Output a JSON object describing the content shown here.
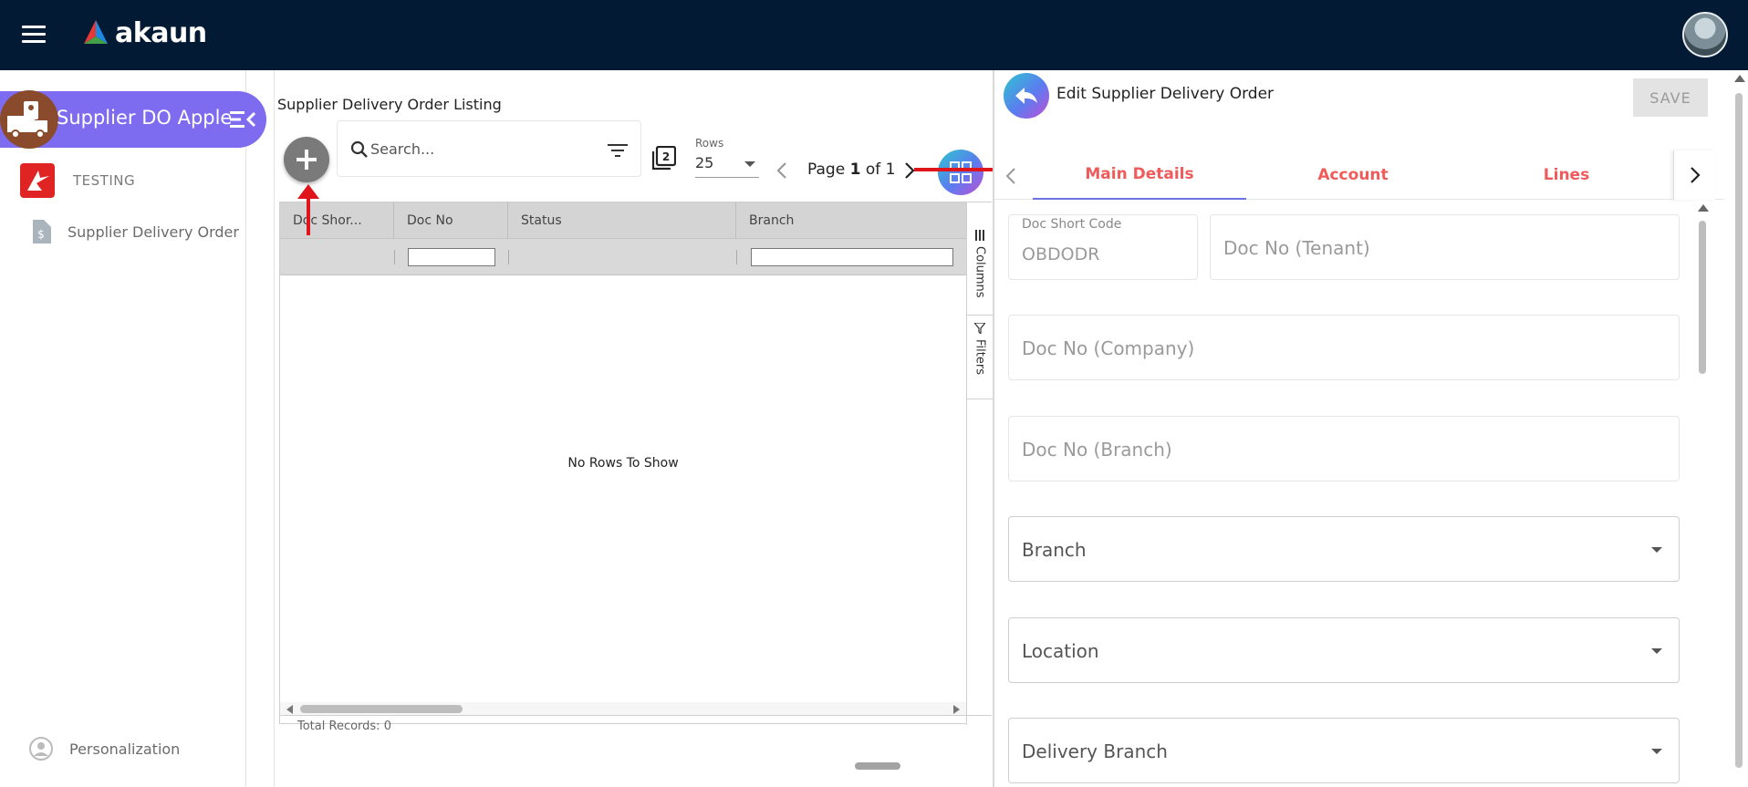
{
  "topbar": {
    "brand": "akaun"
  },
  "sidebar": {
    "app_title": "Supplier DO Apple",
    "items": [
      {
        "label": "TESTING"
      },
      {
        "label": "Supplier Delivery Order"
      }
    ],
    "personalization": "Personalization"
  },
  "listing": {
    "title": "Supplier Delivery Order Listing",
    "search_placeholder": "Search...",
    "rows_label": "Rows",
    "rows_value": "25",
    "pager": {
      "prefix": "Page",
      "current": "1",
      "middle": "of",
      "total": "1"
    },
    "columns": [
      "Doc Shor...",
      "Doc No",
      "Status",
      "Branch"
    ],
    "no_rows": "No Rows To Show",
    "side_tabs": [
      "Columns",
      "Filters"
    ],
    "total_records": "Total Records: 0"
  },
  "edit": {
    "title": "Edit Supplier Delivery Order",
    "save_label": "SAVE",
    "tabs": [
      "Main Details",
      "Account",
      "Lines"
    ],
    "fields": {
      "doc_short_code_label": "Doc Short Code",
      "doc_short_code_value": "OBDODR",
      "doc_no_tenant": "Doc No (Tenant)",
      "doc_no_company": "Doc No (Company)",
      "doc_no_branch": "Doc No (Branch)",
      "branch": "Branch",
      "location": "Location",
      "delivery_branch": "Delivery Branch"
    }
  },
  "colors": {
    "topbar": "#021a33",
    "app_pill": "#7d6bf0",
    "tab_text": "#ef5b5b",
    "tab_indicator": "#6b73e0",
    "annotation_arrow": "#e0141b"
  }
}
